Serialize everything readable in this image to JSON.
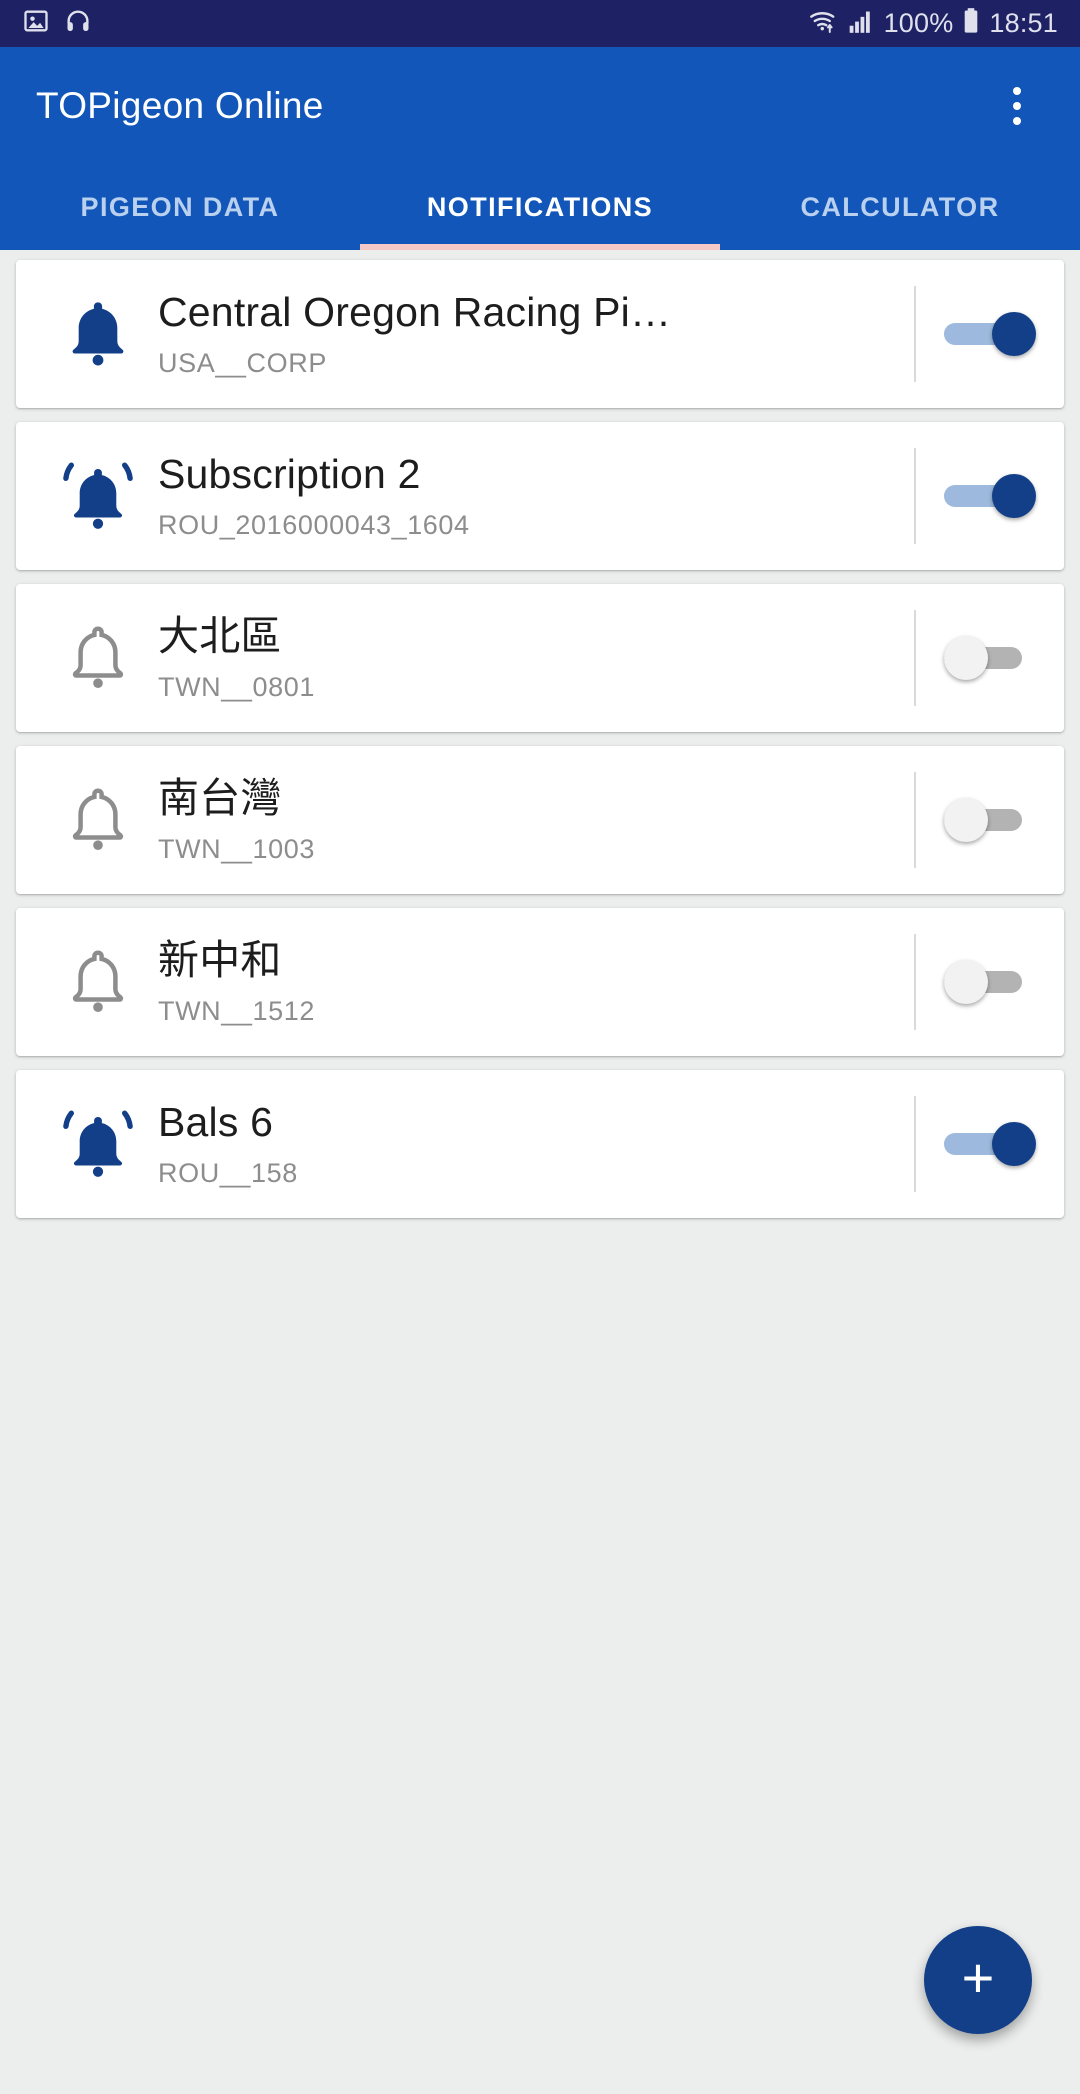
{
  "status_bar": {
    "time": "18:51",
    "battery_text": "100%",
    "icons": [
      "image-icon",
      "headphones-icon",
      "wifi-icon",
      "signal-icon",
      "battery-icon"
    ],
    "background_color": "#1e2264"
  },
  "app_bar": {
    "title": "TOPigeon Online",
    "overflow_label": "more-options",
    "background_color": "#1156b8"
  },
  "tabs": {
    "indicator_color": "#f6c9c6",
    "items": [
      {
        "label": "PIGEON DATA",
        "active": false
      },
      {
        "label": "NOTIFICATIONS",
        "active": true
      },
      {
        "label": "CALCULATOR",
        "active": false
      }
    ]
  },
  "notifications": {
    "items": [
      {
        "title": "Central Oregon Racing Pi…",
        "subtitle": "USA__CORP",
        "enabled": true,
        "bell": "bell-filled-icon"
      },
      {
        "title": "Subscription 2",
        "subtitle": "ROU_2016000043_1604",
        "enabled": true,
        "bell": "bell-ringing-icon"
      },
      {
        "title": "大北區",
        "subtitle": "TWN__0801",
        "enabled": false,
        "bell": "bell-outline-icon"
      },
      {
        "title": "南台灣",
        "subtitle": "TWN__1003",
        "enabled": false,
        "bell": "bell-outline-icon"
      },
      {
        "title": "新中和",
        "subtitle": "TWN__1512",
        "enabled": false,
        "bell": "bell-outline-icon"
      },
      {
        "title": "Bals 6",
        "subtitle": "ROU__158",
        "enabled": true,
        "bell": "bell-ringing-icon"
      }
    ]
  },
  "fab": {
    "label": "+",
    "color": "#123f88"
  },
  "colors": {
    "accent_blue": "#1156b8",
    "dark_navy": "#123f88",
    "bell_on": "#123f88",
    "bell_off": "#8d8d8d",
    "switch_on_track": "#9db9dd",
    "switch_off_track": "#b3b3b3"
  }
}
